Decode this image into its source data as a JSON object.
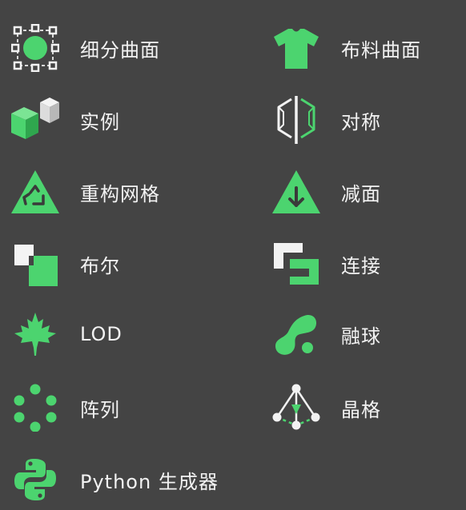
{
  "theme": {
    "background": "#444444",
    "accent": "#4cd46f",
    "text": "#f2f2f2"
  },
  "tools": {
    "left": [
      {
        "label": "细分曲面",
        "icon": "subdivision-surface-icon"
      },
      {
        "label": "实例",
        "icon": "instance-cubes-icon"
      },
      {
        "label": "重构网格",
        "icon": "remesh-triangle-icon"
      },
      {
        "label": "布尔",
        "icon": "boolean-squares-icon"
      },
      {
        "label": "LOD",
        "icon": "maple-leaf-icon"
      },
      {
        "label": "阵列",
        "icon": "array-dots-icon"
      },
      {
        "label": "Python 生成器",
        "icon": "python-logo-icon"
      }
    ],
    "right": [
      {
        "label": "布料曲面",
        "icon": "cloth-tshirt-icon"
      },
      {
        "label": "对称",
        "icon": "symmetry-icon"
      },
      {
        "label": "减面",
        "icon": "decimate-triangle-icon"
      },
      {
        "label": "连接",
        "icon": "connect-icon"
      },
      {
        "label": "融球",
        "icon": "metaball-icon"
      },
      {
        "label": "晶格",
        "icon": "lattice-icon"
      }
    ]
  }
}
